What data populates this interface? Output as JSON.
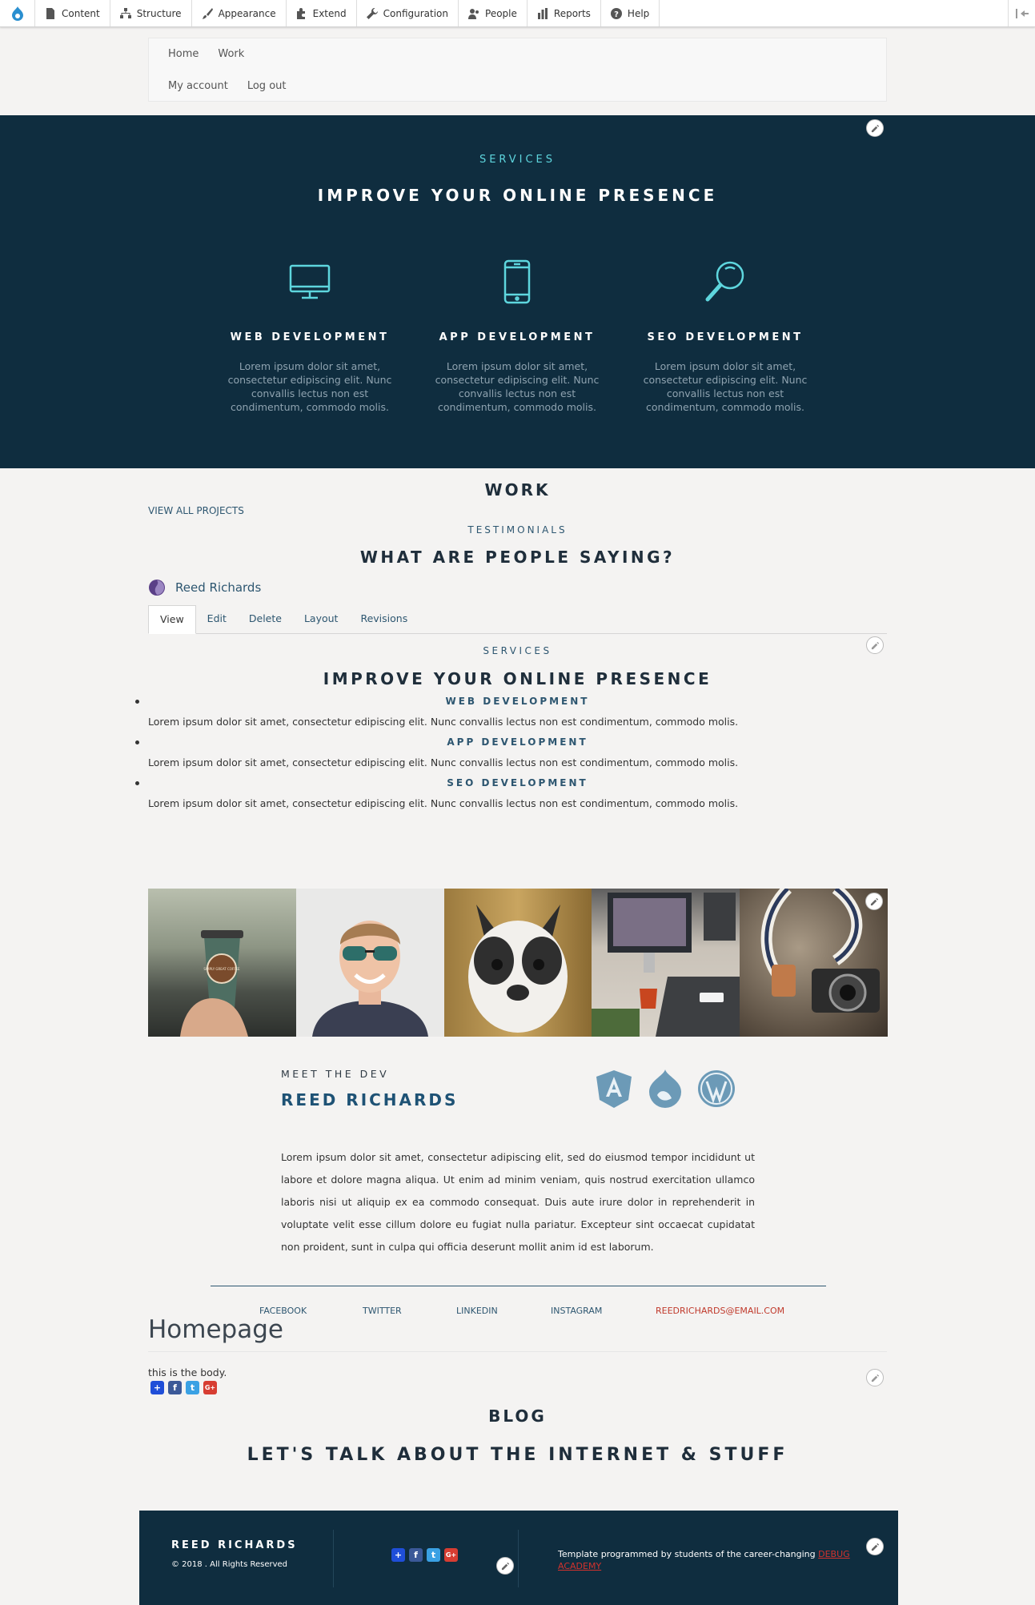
{
  "toolbar": {
    "items": [
      "Content",
      "Structure",
      "Appearance",
      "Extend",
      "Configuration",
      "People",
      "Reports",
      "Help"
    ]
  },
  "nav": {
    "main": [
      "Home",
      "Work"
    ],
    "account": [
      "My account",
      "Log out"
    ]
  },
  "hero": {
    "eyebrow": "SERVICES",
    "title": "IMPROVE YOUR ONLINE PRESENCE",
    "accent_color": "#5ed6de",
    "background": "#0f2d3f",
    "services": [
      {
        "icon": "monitor-icon",
        "title": "WEB DEVELOPMENT",
        "text": "Lorem ipsum dolor sit amet, consectetur edipiscing elit. Nunc convallis lectus non est condimentum, commodo molis."
      },
      {
        "icon": "phone-icon",
        "title": "APP DEVELOPMENT",
        "text": "Lorem ipsum dolor sit amet, consectetur edipiscing elit. Nunc convallis lectus non est condimentum, commodo molis."
      },
      {
        "icon": "search-icon",
        "title": "SEO DEVELOPMENT",
        "text": "Lorem ipsum dolor sit amet, consectetur edipiscing elit. Nunc convallis lectus non est condimentum, commodo molis."
      }
    ]
  },
  "work": {
    "title": "WORK",
    "view_all": "VIEW ALL PROJECTS",
    "testimonials": "TESTIMONIALS",
    "what": "WHAT ARE PEOPLE SAYING?"
  },
  "author": {
    "name": "Reed Richards"
  },
  "tabs": [
    "View",
    "Edit",
    "Delete",
    "Layout",
    "Revisions"
  ],
  "services_list": {
    "eyebrow": "SERVICES",
    "title": "IMPROVE YOUR ONLINE PRESENCE",
    "items": [
      {
        "title": "WEB DEVELOPMENT",
        "text": "Lorem ipsum dolor sit amet, consectetur edipiscing elit. Nunc convallis lectus non est condimentum, commodo molis."
      },
      {
        "title": "APP DEVELOPMENT",
        "text": "Lorem ipsum dolor sit amet, consectetur edipiscing elit. Nunc convallis lectus non est condimentum, commodo molis."
      },
      {
        "title": "SEO DEVELOPMENT",
        "text": "Lorem ipsum dolor sit amet, consectetur edipiscing elit. Nunc convallis lectus non est condimentum, commodo molis."
      }
    ]
  },
  "gallery": {
    "coffee_text": "SIMPLY GREAT COFFEE"
  },
  "meet": {
    "eyebrow": "MEET THE DEV",
    "name": "REED RICHARDS",
    "bio": "Lorem ipsum dolor sit amet, consectetur adipiscing elit, sed do eiusmod tempor incididunt ut labore et dolore magna aliqua. Ut enim ad minim veniam, quis nostrud exercitation ullamco laboris nisi ut aliquip ex ea commodo consequat. Duis aute irure dolor in reprehenderit in voluptate velit esse cillum dolore eu fugiat nulla pariatur. Excepteur sint occaecat cupidatat non proident, sunt in culpa qui officia deserunt mollit anim id est laborum."
  },
  "socials": {
    "facebook": "FACEBOOK",
    "twitter": "TWITTER",
    "linkedin": "LINKEDIN",
    "instagram": "INSTAGRAM",
    "email": "REEDRICHARDS@EMAIL.COM"
  },
  "homepage": {
    "title": "Homepage",
    "body": "this is the body."
  },
  "share_buttons": {
    "plus": "+",
    "facebook": "f",
    "twitter": "t",
    "google": "G+"
  },
  "blog": {
    "title": "BLOG",
    "subtitle": "LET'S TALK ABOUT THE INTERNET & STUFF"
  },
  "footer": {
    "name": "REED RICHARDS",
    "copyright": "© 2018 . All Rights Reserved",
    "credit_prefix": "Template programmed by students of the career-changing ",
    "credit_link": "DEBUG ACADEMY"
  }
}
